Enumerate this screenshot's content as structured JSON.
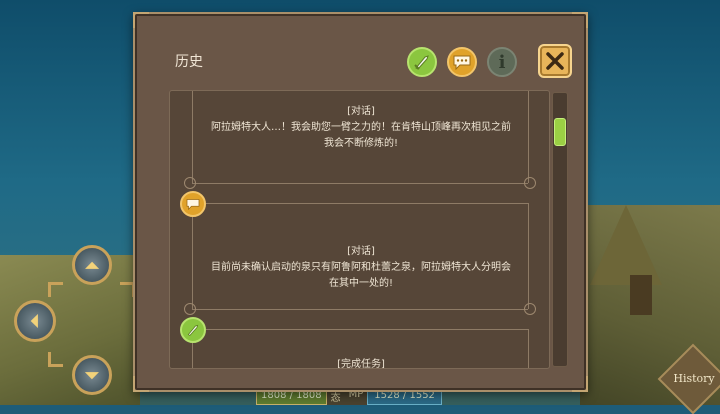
{
  "panel": {
    "title": "历史"
  },
  "toolbar": {
    "quest_filter_icon": "quest-sword-icon",
    "dialog_filter_icon": "speech-bubble-icon",
    "info_filter_label": "i",
    "close_icon": "close-x-icon"
  },
  "log": {
    "entries": [
      {
        "type_label": "[对话]",
        "text": "阿拉姆特大人…！我会助您一臂之力的！在肯特山顶峰再次相见之前我会不断修炼的!"
      },
      {
        "type_label": "[对话]",
        "text": "目前尚未确认启动的泉只有阿鲁阿和杜蕾之泉，阿拉姆特大人分明会在其中一处的!"
      },
      {
        "type_label": "[完成任务]",
        "text": ""
      }
    ],
    "node_icons": [
      "speech-bubble-icon",
      "quest-sword-icon"
    ]
  },
  "hud": {
    "hp": "1808 / 1808",
    "status_tag": "态",
    "mp_label": "MP",
    "mp": "1528 / 1552",
    "history_button": "History"
  },
  "colors": {
    "panel_bg": "#6a5647",
    "accent_green": "#8bc63f",
    "accent_orange": "#e0a22a",
    "close_yellow": "#e8b55a"
  }
}
